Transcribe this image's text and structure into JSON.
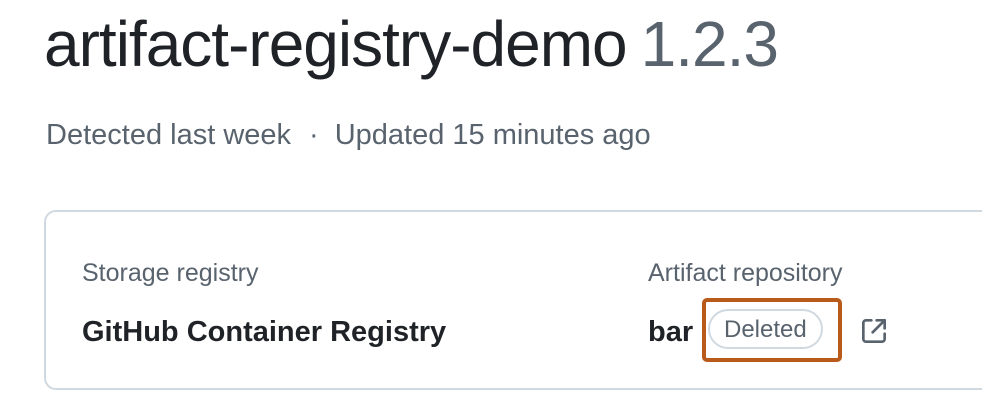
{
  "package": {
    "name": "artifact-registry-demo",
    "version": "1.2.3"
  },
  "meta": {
    "detected": "Detected last week",
    "separator": "·",
    "updated": "Updated 15 minutes ago"
  },
  "card": {
    "storage_label": "Storage registry",
    "storage_value": "GitHub Container Registry",
    "repo_label": "Artifact repository",
    "repo_value": "bar",
    "repo_status": "Deleted",
    "link_icon": "external-link-icon"
  },
  "colors": {
    "text_primary": "#1f2328",
    "text_muted": "#59636e",
    "border": "#d1d9e0",
    "highlight": "#b85a1a"
  }
}
